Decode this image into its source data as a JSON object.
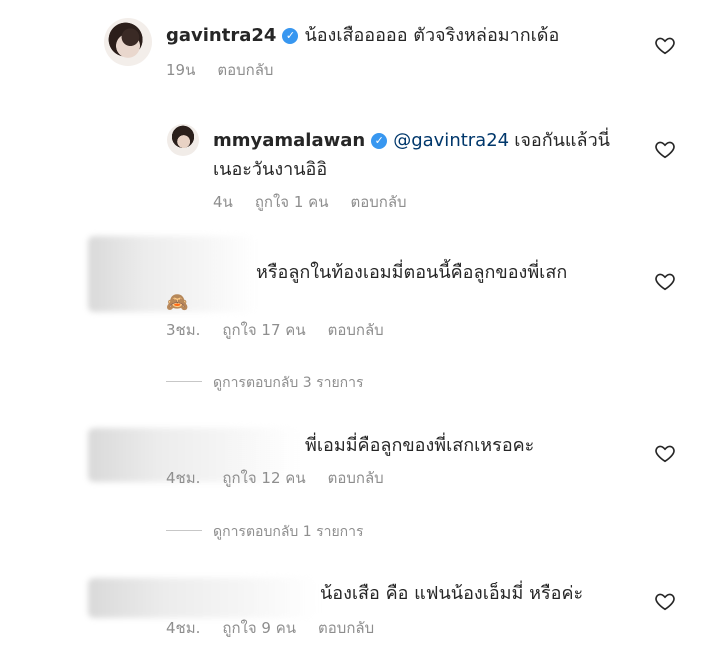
{
  "comments": [
    {
      "username": "gavintra24",
      "text": "น้องเสือออออ ตัวจริงหล่อมากเด้อ",
      "time": "19น",
      "reply_label": "ตอบกลับ"
    },
    {
      "username": "mmyamalawan",
      "mention": "@gavintra24",
      "text_line1": "เจอกันแล้วนี่",
      "text_line2": "เนอะวันงานอิอิ",
      "time": "4น",
      "likes": "ถูกใจ 1 คน",
      "reply_label": "ตอบกลับ"
    },
    {
      "text_line1": "หรือลูกในท้องเอมมี่ตอนนี้คือลูกของพี่เสก",
      "emoji": "🙈",
      "time": "3ชม.",
      "likes": "ถูกใจ 17 คน",
      "reply_label": "ตอบกลับ",
      "view_replies": "ดูการตอบกลับ 3 รายการ"
    },
    {
      "text": "พี่เอมมี่คือลูกของพี่เสกเหรอคะ",
      "time": "4ชม.",
      "likes": "ถูกใจ 12 คน",
      "reply_label": "ตอบกลับ",
      "view_replies": "ดูการตอบกลับ 1 รายการ"
    },
    {
      "text": "น้องเสือ คือ แฟนน้องเอ็มมี่ หรือค่ะ",
      "time": "4ชม.",
      "likes": "ถูกใจ 9 คน",
      "reply_label": "ตอบกลับ"
    }
  ],
  "colors": {
    "verified": "#3897f0",
    "mention": "#00376b",
    "meta": "#8e8e8e"
  },
  "icons": {
    "like": "heart-outline-icon",
    "verified": "verified-badge-icon"
  }
}
